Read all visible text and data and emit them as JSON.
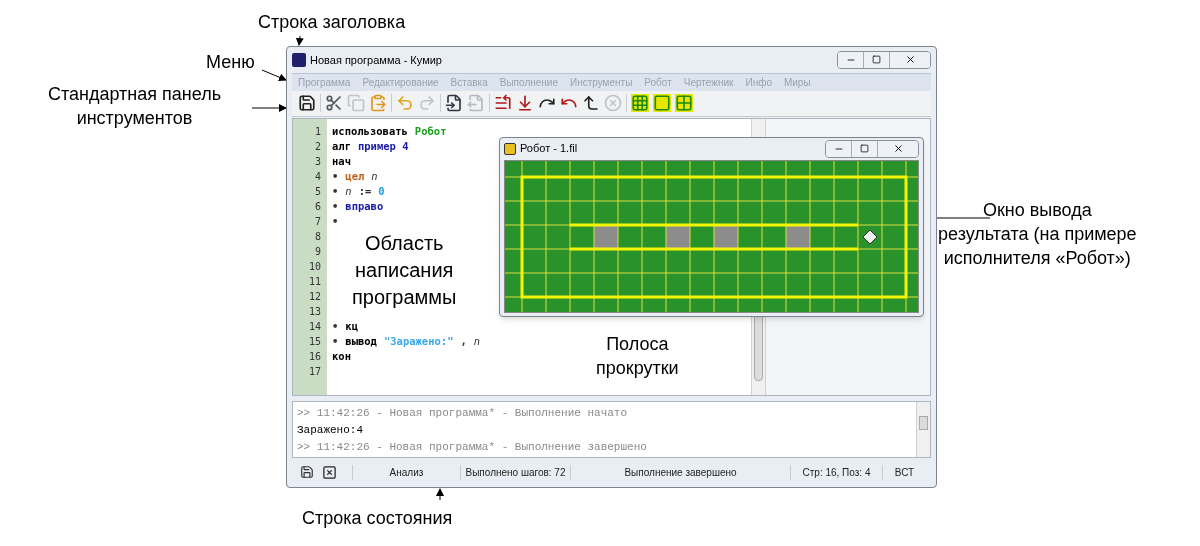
{
  "annotations": [
    {
      "lines": [
        "Строка заголовка"
      ]
    },
    {
      "lines": [
        "Меню"
      ]
    },
    {
      "lines": [
        "Стандартная панель",
        "инструментов"
      ]
    },
    {
      "lines": [
        "Окно вывода",
        "результата (на примере",
        "исполнителя «Робот»)"
      ]
    },
    {
      "lines": [
        "Область",
        "написания",
        "программы"
      ]
    },
    {
      "lines": [
        "Полоса",
        "прокрутки"
      ]
    },
    {
      "lines": [
        "Строка состояния"
      ]
    }
  ],
  "window": {
    "title": "Новая программа - Кумир"
  },
  "menu": [
    "Программа",
    "Редактирование",
    "Вставка",
    "Выполнение",
    "Инструменты",
    "Робот",
    "Чертежник",
    "Инфо",
    "Миры"
  ],
  "toolbar_groups": [
    [
      {
        "kind": "save",
        "disabled": false
      }
    ],
    [
      {
        "kind": "cut",
        "disabled": false
      },
      {
        "kind": "copy",
        "disabled": true
      },
      {
        "kind": "paste",
        "disabled": false
      }
    ],
    [
      {
        "kind": "undo",
        "disabled": false
      },
      {
        "kind": "redo",
        "disabled": true
      }
    ],
    [
      {
        "kind": "doc-in",
        "disabled": false
      },
      {
        "kind": "doc-out",
        "disabled": true
      }
    ],
    [
      {
        "kind": "run-start",
        "disabled": false
      },
      {
        "kind": "run-down",
        "disabled": false
      },
      {
        "kind": "step-over",
        "disabled": false
      },
      {
        "kind": "step-in",
        "disabled": false
      },
      {
        "kind": "step-out",
        "disabled": false
      },
      {
        "kind": "stop",
        "disabled": true
      }
    ],
    [
      {
        "kind": "grid",
        "disabled": false
      },
      {
        "kind": "frame",
        "disabled": false
      },
      {
        "kind": "cross",
        "disabled": false
      }
    ]
  ],
  "editor": {
    "lines": [
      {
        "number": "1",
        "tokens": [
          {
            "text": "использовать",
            "kind": "keyword"
          },
          {
            "text": "Робот",
            "kind": "module"
          }
        ]
      },
      {
        "number": "2",
        "tokens": [
          {
            "text": "алг",
            "kind": "keyword"
          },
          {
            "text": "пример 4",
            "kind": "name"
          }
        ]
      },
      {
        "number": "3",
        "tokens": [
          {
            "text": "нач",
            "kind": "keyword"
          }
        ]
      },
      {
        "number": "4",
        "tokens": [
          {
            "text": "•",
            "kind": "plain"
          },
          {
            "text": "цел",
            "kind": "type"
          },
          {
            "text": "n",
            "kind": "var"
          }
        ]
      },
      {
        "number": "5",
        "tokens": [
          {
            "text": "•",
            "kind": "plain"
          },
          {
            "text": "n",
            "kind": "var"
          },
          {
            "text": ":=",
            "kind": "plain"
          },
          {
            "text": "0",
            "kind": "number"
          }
        ]
      },
      {
        "number": "6",
        "tokens": [
          {
            "text": "•",
            "kind": "plain"
          },
          {
            "text": "вправо",
            "kind": "name"
          }
        ]
      },
      {
        "number": "7",
        "tokens": [
          {
            "text": "•",
            "kind": "plain"
          }
        ]
      },
      {
        "number": "8"
      },
      {
        "number": "9"
      },
      {
        "number": "10"
      },
      {
        "number": "11"
      },
      {
        "number": "12"
      },
      {
        "number": "13"
      },
      {
        "number": "14",
        "tokens": [
          {
            "text": "•",
            "kind": "plain"
          },
          {
            "text": "кц",
            "kind": "keyword"
          }
        ]
      },
      {
        "number": "15",
        "tokens": [
          {
            "text": "•",
            "kind": "plain"
          },
          {
            "text": "вывод",
            "kind": "keyword"
          },
          {
            "text": "\"Заражено:\"",
            "kind": "string"
          },
          {
            "text": ",",
            "kind": "plain"
          },
          {
            "text": "n",
            "kind": "var"
          }
        ]
      },
      {
        "number": "16",
        "tokens": [
          {
            "text": "кон",
            "kind": "keyword"
          }
        ]
      },
      {
        "number": "17"
      }
    ]
  },
  "robot_window": {
    "title": "Робот - 1.fil"
  },
  "output": [
    {
      "text": ">> 11:42:26 - Новая программа* - Выполнение начато",
      "kind": "log"
    },
    {
      "text": "Заражено:4",
      "kind": "output"
    },
    {
      "text": ">> 11:42:26 - Новая программа* - Выполнение завершено",
      "kind": "log"
    }
  ],
  "status_bar": [
    "Анализ",
    "Выполнено шагов: 72",
    "Выполнение завершено",
    "Стр: 16, Поз: 4",
    "ВСТ"
  ]
}
